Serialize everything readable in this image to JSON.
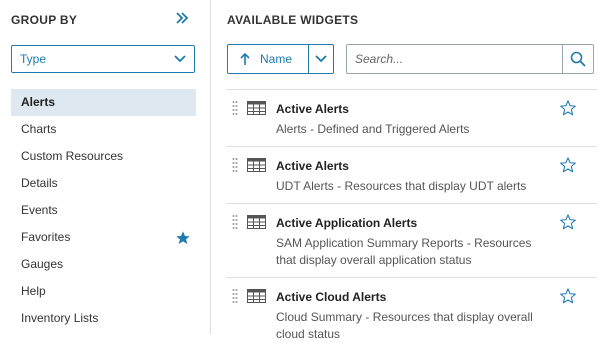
{
  "left": {
    "title": "GROUP BY",
    "select_value": "Type",
    "items": [
      {
        "label": "Alerts",
        "active": true
      },
      {
        "label": "Charts"
      },
      {
        "label": "Custom Resources"
      },
      {
        "label": "Details"
      },
      {
        "label": "Events"
      },
      {
        "label": "Favorites",
        "starred": true
      },
      {
        "label": "Gauges"
      },
      {
        "label": "Help"
      },
      {
        "label": "Inventory Lists"
      }
    ]
  },
  "right": {
    "title": "AVAILABLE WIDGETS",
    "sort_label": "Name",
    "search_placeholder": "Search...",
    "widgets": [
      {
        "title": "Active Alerts",
        "desc": "Alerts - Defined and Triggered Alerts"
      },
      {
        "title": "Active Alerts",
        "desc": "UDT Alerts - Resources that display UDT alerts"
      },
      {
        "title": "Active Application Alerts",
        "desc": "SAM Application Summary Reports - Resources that display overall application status"
      },
      {
        "title": "Active Cloud Alerts",
        "desc": "Cloud Summary - Resources that display overall cloud status"
      }
    ]
  },
  "colors": {
    "accent": "#1f7ab0",
    "active_bg": "#dde8f1",
    "border": "#d9dde1"
  }
}
